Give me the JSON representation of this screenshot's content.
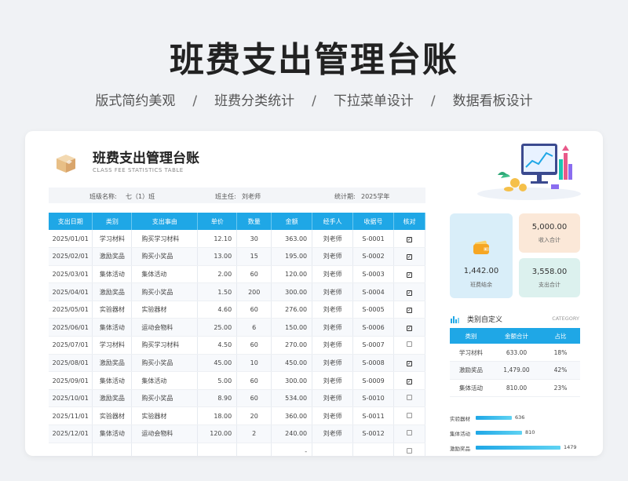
{
  "hero": {
    "title": "班费支出管理台账",
    "features": [
      "版式简约美观",
      "班费分类统计",
      "下拉菜单设计",
      "数据看板设计"
    ],
    "separator": "/"
  },
  "sheet": {
    "title": "班费支出管理台账",
    "subtitle": "CLASS FEE STATISTICS TABLE",
    "info": {
      "class_label": "班级名称:",
      "class_value": "七（1）班",
      "teacher_label": "班主任:",
      "teacher_value": "刘老师",
      "period_label": "统计期:",
      "period_value": "2025学年"
    }
  },
  "table": {
    "headers": [
      "支出日期",
      "类别",
      "支出事由",
      "单价",
      "数量",
      "金额",
      "经手人",
      "收据号",
      "核对"
    ],
    "rows": [
      {
        "date": "2025/01/01",
        "cat": "学习材料",
        "reason": "购买学习材料",
        "price": "12.10",
        "qty": "30",
        "amount": "363.00",
        "handler": "刘老师",
        "receipt": "S-0001",
        "checked": true
      },
      {
        "date": "2025/02/01",
        "cat": "激励奖品",
        "reason": "购买小奖品",
        "price": "13.00",
        "qty": "15",
        "amount": "195.00",
        "handler": "刘老师",
        "receipt": "S-0002",
        "checked": true
      },
      {
        "date": "2025/03/01",
        "cat": "集体活动",
        "reason": "集体活动",
        "price": "2.00",
        "qty": "60",
        "amount": "120.00",
        "handler": "刘老师",
        "receipt": "S-0003",
        "checked": true
      },
      {
        "date": "2025/04/01",
        "cat": "激励奖品",
        "reason": "购买小奖品",
        "price": "1.50",
        "qty": "200",
        "amount": "300.00",
        "handler": "刘老师",
        "receipt": "S-0004",
        "checked": true
      },
      {
        "date": "2025/05/01",
        "cat": "实验器材",
        "reason": "实验器材",
        "price": "4.60",
        "qty": "60",
        "amount": "276.00",
        "handler": "刘老师",
        "receipt": "S-0005",
        "checked": true
      },
      {
        "date": "2025/06/01",
        "cat": "集体活动",
        "reason": "运动会物料",
        "price": "25.00",
        "qty": "6",
        "amount": "150.00",
        "handler": "刘老师",
        "receipt": "S-0006",
        "checked": true
      },
      {
        "date": "2025/07/01",
        "cat": "学习材料",
        "reason": "购买学习材料",
        "price": "4.50",
        "qty": "60",
        "amount": "270.00",
        "handler": "刘老师",
        "receipt": "S-0007",
        "checked": false
      },
      {
        "date": "2025/08/01",
        "cat": "激励奖品",
        "reason": "购买小奖品",
        "price": "45.00",
        "qty": "10",
        "amount": "450.00",
        "handler": "刘老师",
        "receipt": "S-0008",
        "checked": true
      },
      {
        "date": "2025/09/01",
        "cat": "集体活动",
        "reason": "集体活动",
        "price": "5.00",
        "qty": "60",
        "amount": "300.00",
        "handler": "刘老师",
        "receipt": "S-0009",
        "checked": true
      },
      {
        "date": "2025/10/01",
        "cat": "激励奖品",
        "reason": "购买小奖品",
        "price": "8.90",
        "qty": "60",
        "amount": "534.00",
        "handler": "刘老师",
        "receipt": "S-0010",
        "checked": false
      },
      {
        "date": "2025/11/01",
        "cat": "实验器材",
        "reason": "实验器材",
        "price": "18.00",
        "qty": "20",
        "amount": "360.00",
        "handler": "刘老师",
        "receipt": "S-0011",
        "checked": false
      },
      {
        "date": "2025/12/01",
        "cat": "集体活动",
        "reason": "运动会物料",
        "price": "120.00",
        "qty": "2",
        "amount": "240.00",
        "handler": "刘老师",
        "receipt": "S-0012",
        "checked": false
      },
      {
        "date": "",
        "cat": "",
        "reason": "",
        "price": "",
        "qty": "",
        "amount": "-",
        "handler": "",
        "receipt": "",
        "checked": false
      }
    ]
  },
  "stats": {
    "balance_value": "1,442.00",
    "balance_label": "班费结余",
    "income_value": "5,000.00",
    "income_label": "收入合计",
    "expense_value": "3,558.00",
    "expense_label": "支出合计"
  },
  "category": {
    "title": "类别自定义",
    "title_en": "CATEGORY",
    "headers": [
      "类别",
      "金额合计",
      "占比"
    ],
    "rows": [
      {
        "name": "学习材料",
        "total": "633.00",
        "pct": "18%"
      },
      {
        "name": "激励奖品",
        "total": "1,479.00",
        "pct": "42%"
      },
      {
        "name": "集体活动",
        "total": "810.00",
        "pct": "23%"
      }
    ],
    "bars": [
      {
        "name": "实验器材",
        "value": 636
      },
      {
        "name": "集体活动",
        "value": 810
      },
      {
        "name": "激励奖品",
        "value": 1479
      }
    ]
  },
  "colors": {
    "accent": "#1fa7e6",
    "balance_bg": "#d9eef9",
    "income_bg": "#fbe8d8",
    "expense_bg": "#dcf1ee"
  }
}
